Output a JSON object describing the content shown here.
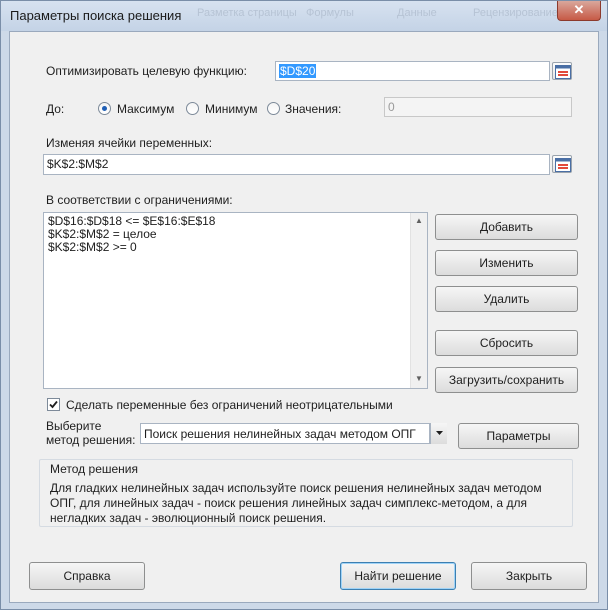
{
  "window": {
    "title": "Параметры поиска решения",
    "bg_ribbon": [
      "Разметка страницы",
      "Формулы",
      "Данные",
      "Рецензирование"
    ],
    "close_glyph": "✕"
  },
  "objective": {
    "label": "Оптимизировать целевую функцию:",
    "value": "$D$20"
  },
  "to": {
    "label": "До:",
    "options": [
      "Максимум",
      "Минимум",
      "Значения:"
    ],
    "selected": "Максимум",
    "value_field": "0"
  },
  "variables": {
    "label": "Изменяя ячейки переменных:",
    "value": "$K$2:$M$2"
  },
  "constraints": {
    "label": "В соответствии с ограничениями:",
    "items": [
      "$D$16:$D$18 <= $E$16:$E$18",
      "$K$2:$M$2 = целое",
      "$K$2:$M$2 >= 0"
    ]
  },
  "buttons": {
    "add": "Добавить",
    "change": "Изменить",
    "delete": "Удалить",
    "reset": "Сбросить",
    "load_save": "Загрузить/сохранить",
    "options": "Параметры",
    "help": "Справка",
    "solve": "Найти решение",
    "close": "Закрыть"
  },
  "nonneg": {
    "label": "Сделать переменные без ограничений неотрицательными",
    "checked": true
  },
  "method": {
    "label_line1": "Выберите",
    "label_line2": "метод решения:",
    "selected": "Поиск решения нелинейных задач методом ОПГ"
  },
  "method_group": {
    "title": "Метод решения",
    "description": "Для гладких нелинейных задач используйте поиск решения нелинейных задач методом ОПГ, для линейных задач - поиск решения линейных задач симплекс-методом, а для негладких задач - эволюционный поиск решения."
  },
  "colors": {
    "accent": "#1f5fb6",
    "close": "#c75a46",
    "selection": "#3399ff"
  }
}
